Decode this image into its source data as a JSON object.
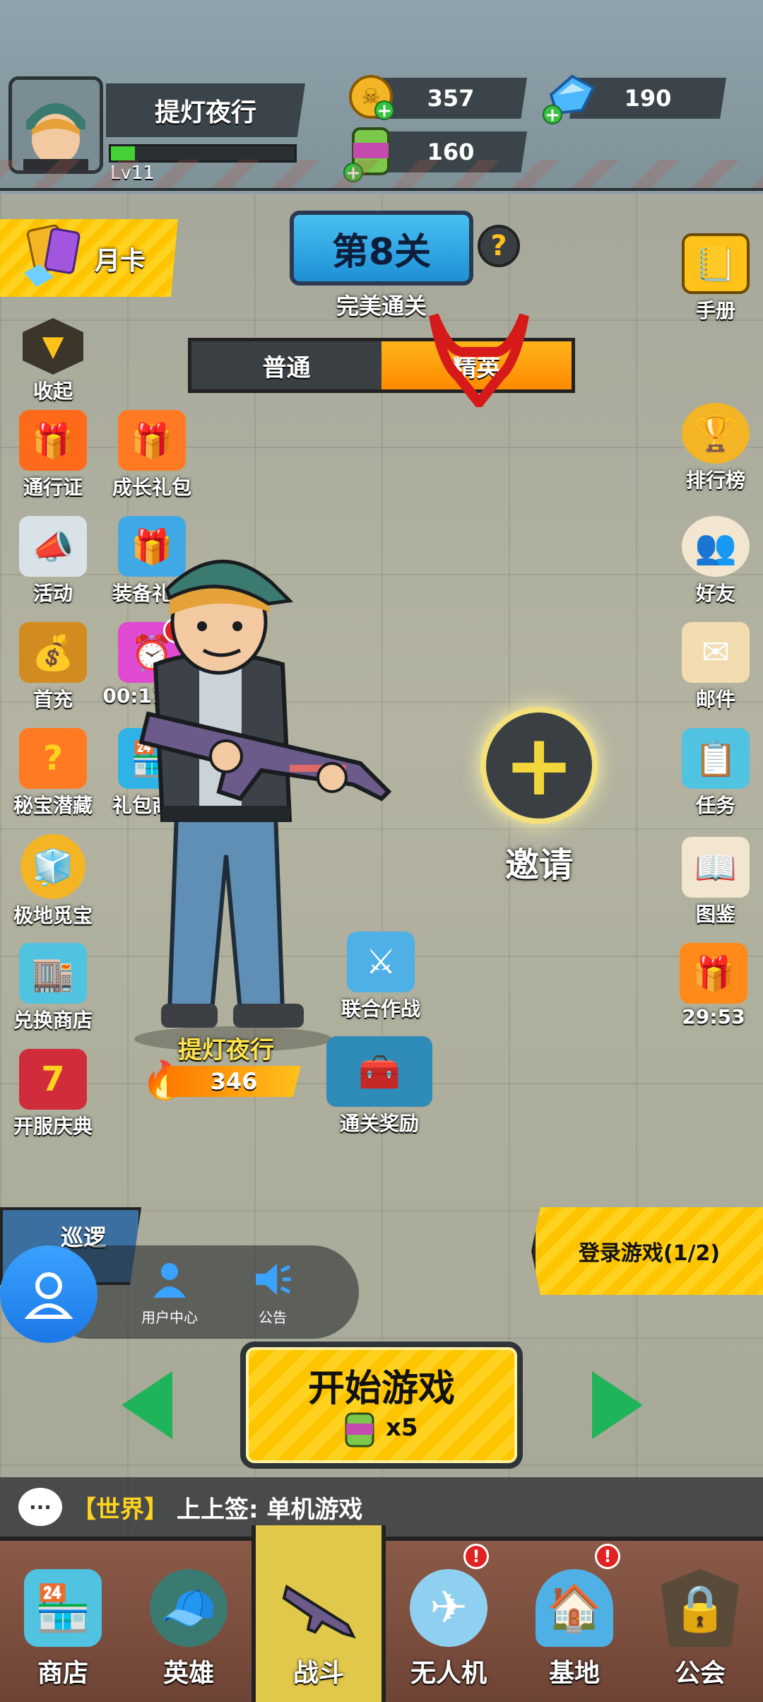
{
  "player": {
    "name": "提灯夜行",
    "level": "Lv11",
    "xp_fraction": 0.13
  },
  "resources": {
    "gold": "357",
    "gems": "190",
    "energy": "160"
  },
  "monthly_card": "月卡",
  "stage": {
    "title": "第8关",
    "status": "完美通关",
    "help": "?",
    "modes": [
      "普通",
      "精英"
    ],
    "active_mode": "精英"
  },
  "left_menu": {
    "collapse": "收起",
    "items": [
      {
        "label": "通行证"
      },
      {
        "label": "成长礼包"
      },
      {
        "label": "活动"
      },
      {
        "label": "装备礼包"
      },
      {
        "label": "首充"
      },
      {
        "label": "00:11:01"
      },
      {
        "label": "秘宝潜藏"
      },
      {
        "label": "礼包商店"
      },
      {
        "label": "极地觅宝"
      },
      {
        "label": "兑换商店"
      },
      {
        "label": "开服庆典"
      }
    ]
  },
  "right_menu": {
    "items": [
      {
        "label": "手册"
      },
      {
        "label": "排行榜"
      },
      {
        "label": "好友"
      },
      {
        "label": "邮件"
      },
      {
        "label": "任务"
      },
      {
        "label": "图鉴"
      },
      {
        "label": "29:53"
      }
    ]
  },
  "invite": {
    "plus": "+",
    "label": "邀请"
  },
  "hero": {
    "name": "提灯夜行",
    "power": "346"
  },
  "center": {
    "joint_battle": "联合作战",
    "clear_reward": "通关奖励"
  },
  "patrol": "巡逻",
  "login_quest": "登录游戏(1/2)",
  "float_menu": {
    "user_center": "用户中心",
    "notice": "公告"
  },
  "start": {
    "label": "开始游戏",
    "cost": "x5"
  },
  "chat": {
    "channel": "【世界】",
    "message": "上上签: 单机游戏"
  },
  "nav": [
    {
      "label": "商店"
    },
    {
      "label": "英雄"
    },
    {
      "label": "战斗"
    },
    {
      "label": "无人机"
    },
    {
      "label": "基地"
    },
    {
      "label": "公会"
    }
  ],
  "colors": {
    "accent_yellow": "#ffc400",
    "active_tab": "#ff8a00",
    "stage_blue": "#1e8fd6",
    "badge_red": "#e02222"
  }
}
